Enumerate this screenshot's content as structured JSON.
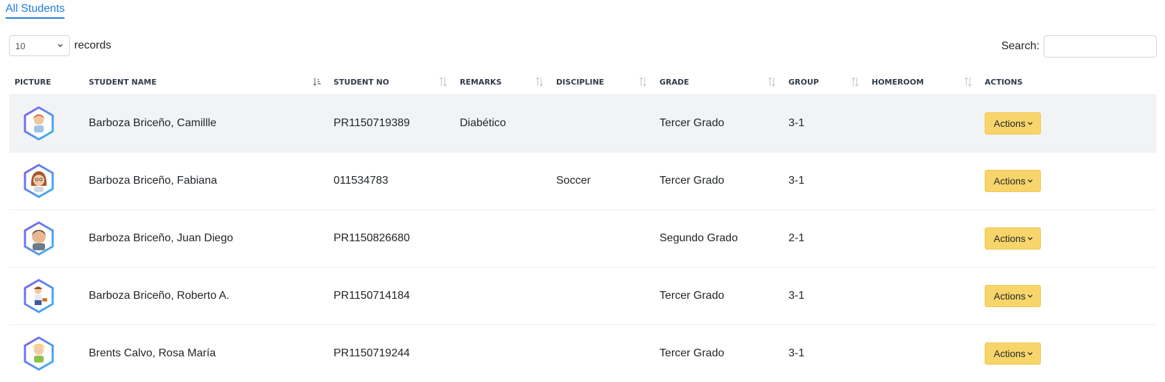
{
  "tab": {
    "label": "All Students"
  },
  "length_control": {
    "selected": "10",
    "label": "records"
  },
  "search": {
    "label": "Search:",
    "value": "",
    "placeholder": ""
  },
  "columns": [
    "Picture",
    "Student Name",
    "Student No",
    "Remarks",
    "Discipline",
    "Grade",
    "Group",
    "Homeroom",
    "Actions"
  ],
  "rows": [
    {
      "name": "Barboza Briceño, Camillle",
      "student_no": "PR1150719389",
      "remarks": "Diabético",
      "discipline": "",
      "grade": "Tercer Grado",
      "group": "3-1",
      "homeroom": "",
      "action": "Actions"
    },
    {
      "name": "Barboza Briceño, Fabiana",
      "student_no": "011534783",
      "remarks": "",
      "discipline": "Soccer",
      "grade": "Tercer Grado",
      "group": "3-1",
      "homeroom": "",
      "action": "Actions"
    },
    {
      "name": "Barboza Briceño, Juan Diego",
      "student_no": "PR1150826680",
      "remarks": "",
      "discipline": "",
      "grade": "Segundo Grado",
      "group": "2-1",
      "homeroom": "",
      "action": "Actions"
    },
    {
      "name": "Barboza Briceño, Roberto A.",
      "student_no": "PR1150714184",
      "remarks": "",
      "discipline": "",
      "grade": "Tercer Grado",
      "group": "3-1",
      "homeroom": "",
      "action": "Actions"
    },
    {
      "name": "Brents Calvo, Rosa María",
      "student_no": "PR1150719244",
      "remarks": "",
      "discipline": "",
      "grade": "Tercer Grado",
      "group": "3-1",
      "homeroom": "",
      "action": "Actions"
    }
  ],
  "colors": {
    "accent": "#1e7be0",
    "action_button": "#f8d56a",
    "row_stripe": "#f2f3f5"
  },
  "icons": {
    "sort": "sort-arrows-icon",
    "sort_active": "sort-ascending-icon",
    "avatar": "student-avatar-icon",
    "dropdown": "chevron-down-icon"
  }
}
